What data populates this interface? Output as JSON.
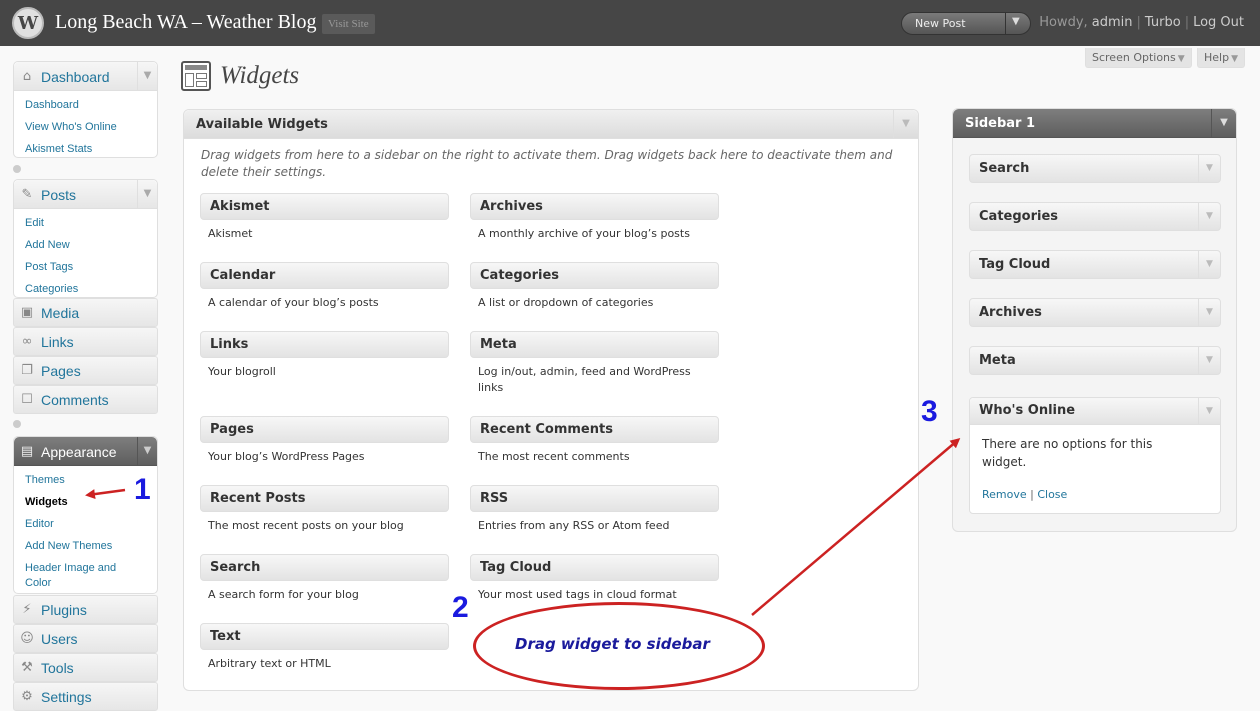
{
  "header": {
    "site_title": "Long Beach WA – Weather Blog",
    "visit_site": "Visit Site",
    "new_post": "New Post",
    "howdy": "Howdy,",
    "user": "admin",
    "turbo": "Turbo",
    "logout": "Log Out"
  },
  "screen_options": "Screen Options",
  "help": "Help",
  "menu": {
    "dashboard": {
      "title": "Dashboard",
      "items": [
        "Dashboard",
        "View Who's Online",
        "Akismet Stats"
      ]
    },
    "posts": {
      "title": "Posts",
      "items": [
        "Edit",
        "Add New",
        "Post Tags",
        "Categories"
      ]
    },
    "media": "Media",
    "links": "Links",
    "pages": "Pages",
    "comments": "Comments",
    "appearance": {
      "title": "Appearance",
      "items": [
        "Themes",
        "Widgets",
        "Editor",
        "Add New Themes",
        "Header Image and Color"
      ]
    },
    "plugins": "Plugins",
    "users": "Users",
    "tools": "Tools",
    "settings": "Settings"
  },
  "page_title": "Widgets",
  "available": {
    "title": "Available Widgets",
    "description": "Drag widgets from here to a sidebar on the right to activate them. Drag widgets back here to deactivate them and delete their settings.",
    "widgets": [
      {
        "name": "Akismet",
        "desc": "Akismet"
      },
      {
        "name": "Archives",
        "desc": "A monthly archive of your blog’s posts"
      },
      {
        "name": "Calendar",
        "desc": "A calendar of your blog’s posts"
      },
      {
        "name": "Categories",
        "desc": "A list or dropdown of categories"
      },
      {
        "name": "Links",
        "desc": "Your blogroll"
      },
      {
        "name": "Meta",
        "desc": "Log in/out, admin, feed and WordPress links"
      },
      {
        "name": "Pages",
        "desc": "Your blog’s WordPress Pages"
      },
      {
        "name": "Recent Comments",
        "desc": "The most recent comments"
      },
      {
        "name": "Recent Posts",
        "desc": "The most recent posts on your blog"
      },
      {
        "name": "RSS",
        "desc": "Entries from any RSS or Atom feed"
      },
      {
        "name": "Search",
        "desc": "A search form for your blog"
      },
      {
        "name": "Tag Cloud",
        "desc": "Your most used tags in cloud format"
      },
      {
        "name": "Text",
        "desc": "Arbitrary text or HTML"
      }
    ]
  },
  "sidebar": {
    "title": "Sidebar 1",
    "widgets": [
      "Search",
      "Categories",
      "Tag Cloud",
      "Archives",
      "Meta"
    ],
    "whos_online": {
      "title": "Who's Online",
      "message": "There are no options for this widget.",
      "remove": "Remove",
      "close": "Close"
    }
  },
  "annotations": {
    "step1": "1",
    "step2": "2",
    "step3": "3",
    "drag_text": "Drag widget to sidebar"
  },
  "colors": {
    "header_bg": "#464646",
    "link": "#21759b",
    "annotation_red": "#cc2222",
    "annotation_blue": "#1a1adf"
  }
}
